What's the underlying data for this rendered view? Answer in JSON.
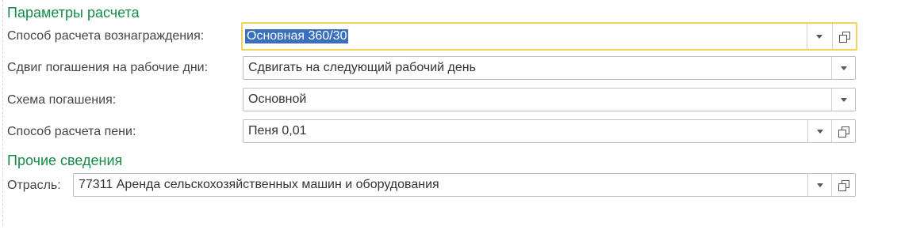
{
  "sections": {
    "calc": {
      "title": "Параметры расчета"
    },
    "other": {
      "title": "Прочие сведения"
    }
  },
  "fields": {
    "reward_method": {
      "label": "Способ расчета вознаграждения:",
      "value": "Основная 360/30"
    },
    "repayment_shift": {
      "label": "Сдвиг погашения на рабочие дни:",
      "value": "Сдвигать на следующий рабочий день"
    },
    "repayment_scheme": {
      "label": "Схема погашения:",
      "value": "Основной"
    },
    "penalty_method": {
      "label": "Способ расчета пени:",
      "value": "Пеня 0,01"
    },
    "industry": {
      "label": "Отрасль:",
      "value": "77311 Аренда сельскохозяйственных машин и оборудования"
    }
  },
  "icons": {
    "dropdown": "chevron-down-icon",
    "open": "open-form-icon"
  },
  "colors": {
    "section_title": "#138a45",
    "focus_border": "#f2d35a",
    "selection": "#3a6fbf"
  }
}
